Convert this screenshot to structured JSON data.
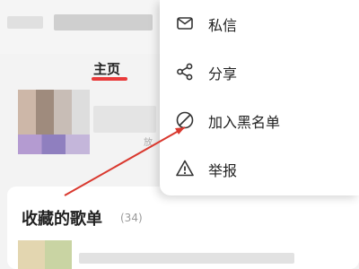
{
  "profile": {
    "tab_home": "主页",
    "play_fragment": "放"
  },
  "section": {
    "title": "收藏的歌单",
    "count": "(34)"
  },
  "menu": {
    "items": [
      {
        "label": "私信",
        "icon": "message-icon"
      },
      {
        "label": "分享",
        "icon": "share-icon"
      },
      {
        "label": "加入黑名单",
        "icon": "block-icon"
      },
      {
        "label": "举报",
        "icon": "report-icon"
      }
    ]
  },
  "colors": {
    "accent_red": "#e93a3a",
    "annotation_arrow": "#d9382e"
  }
}
